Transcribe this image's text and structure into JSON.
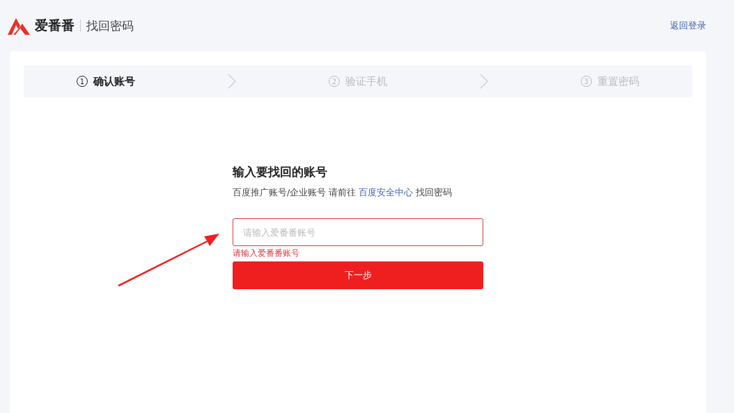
{
  "header": {
    "brand": "爱番番",
    "page_title": "找回密码",
    "back_link": "返回登录"
  },
  "steps": [
    {
      "number": "1",
      "label": "确认账号",
      "selected": true
    },
    {
      "number": "2",
      "label": "验证手机",
      "selected": false
    },
    {
      "number": "3",
      "label": "重置密码",
      "selected": false
    }
  ],
  "form": {
    "title": "输入要找回的账号",
    "note_before": "百度推广账号/企业账号 请前往",
    "note_link": "百度安全中心",
    "note_after": "找回密码",
    "account_field": {
      "placeholder": "请输入爱番番账号",
      "invalid": true
    },
    "error": "请输入爱番番账号",
    "next_button": "下一步"
  }
}
